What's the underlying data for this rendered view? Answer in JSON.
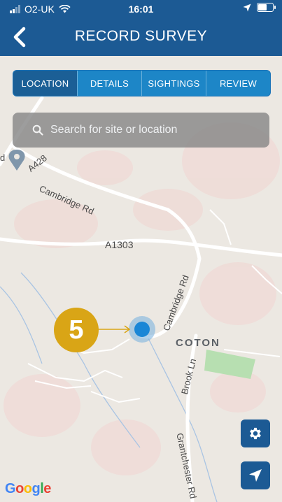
{
  "status_bar": {
    "carrier": "O2-UK",
    "time": "16:01"
  },
  "navbar": {
    "title": "RECORD SURVEY"
  },
  "tabs": [
    {
      "label": "LOCATION"
    },
    {
      "label": "DETAILS"
    },
    {
      "label": "SIGHTINGS"
    },
    {
      "label": "REVIEW"
    }
  ],
  "search": {
    "placeholder": "Search for site or location"
  },
  "step_badge": {
    "number": "5"
  },
  "map": {
    "labels": {
      "a428": "A428",
      "cambridge_rd_1": "Cambridge Rd",
      "a1303": "A1303",
      "cambridge_rd_2": "Cambridge Rd",
      "coton": "COTON",
      "brook_ln": "Brook Ln",
      "grantchester_rd": "Grantchester Rd",
      "d_label": "d"
    },
    "attribution": "Google"
  },
  "colors": {
    "accent": "#1c5a94",
    "tab": "#1d86c7",
    "badge": "#d9a516"
  }
}
